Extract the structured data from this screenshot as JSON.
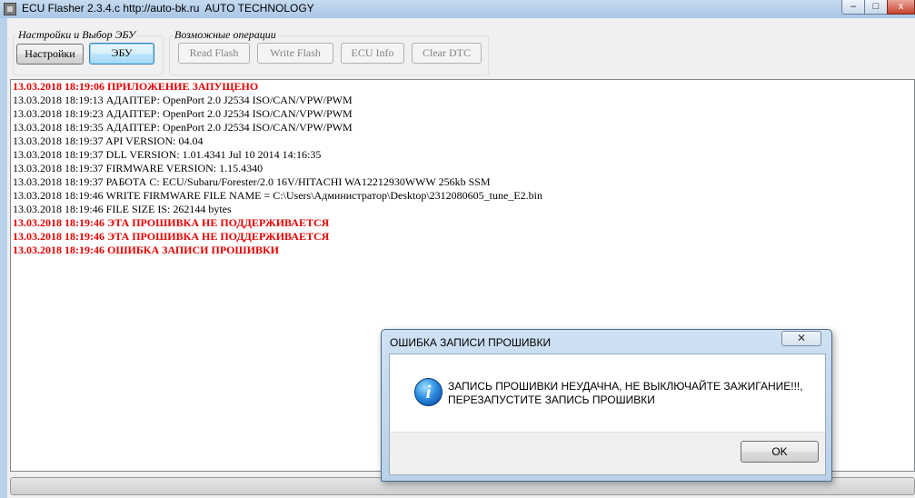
{
  "window": {
    "title": "ECU Flasher 2.3.4.c http://auto-bk.ru  AUTO TECHNOLOGY",
    "minimize_glyph": "–",
    "maximize_glyph": "□",
    "close_glyph": "x"
  },
  "groups": {
    "settings_label": "Настройки и Выбор ЭБУ",
    "operations_label": "Возможные операции"
  },
  "buttons": {
    "settings": "Настройки",
    "ecu": "ЭБУ",
    "read_flash": "Read Flash",
    "write_flash": "Write Flash",
    "ecu_info": "ECU Info",
    "clear_dtc": "Clear DTC"
  },
  "log": [
    {
      "text": "13.03.2018 18:19:06 ПРИЛОЖЕНИЕ ЗАПУЩЕНО",
      "error": true
    },
    {
      "text": "13.03.2018 18:19:13 АДАПТЕР: OpenPort 2.0 J2534 ISO/CAN/VPW/PWM",
      "error": false
    },
    {
      "text": "13.03.2018 18:19:23 АДАПТЕР: OpenPort 2.0 J2534 ISO/CAN/VPW/PWM",
      "error": false
    },
    {
      "text": "13.03.2018 18:19:35 АДАПТЕР: OpenPort 2.0 J2534 ISO/CAN/VPW/PWM",
      "error": false
    },
    {
      "text": "13.03.2018 18:19:37 API VERSION: 04.04",
      "error": false
    },
    {
      "text": "13.03.2018 18:19:37 DLL VERSION: 1.01.4341 Jul 10 2014 14:16:35",
      "error": false
    },
    {
      "text": "13.03.2018 18:19:37 FIRMWARE VERSION: 1.15.4340",
      "error": false
    },
    {
      "text": "13.03.2018 18:19:37 РАБОТА С: ECU/Subaru/Forester/2.0 16V/HITACHI WA12212930WWW 256kb SSM",
      "error": false
    },
    {
      "text": "13.03.2018 18:19:46 WRITE FIRMWARE FILE NAME = C:\\Users\\Администратор\\Desktop\\2312080605_tune_E2.bin",
      "error": false
    },
    {
      "text": "13.03.2018 18:19:46 FILE SIZE IS: 262144 bytes",
      "error": false
    },
    {
      "text": "13.03.2018 18:19:46 ЭТА ПРОШИВКА НЕ ПОДДЕРЖИВАЕТСЯ",
      "error": true
    },
    {
      "text": "13.03.2018 18:19:46 ЭТА ПРОШИВКА НЕ ПОДДЕРЖИВАЕТСЯ",
      "error": true
    },
    {
      "text": "13.03.2018 18:19:46 ОШИБКА ЗАПИСИ ПРОШИВКИ",
      "error": true
    }
  ],
  "log_colors": {
    "normal": "#000000",
    "error": "#e60000"
  },
  "progress": {
    "value": 0
  },
  "dialog": {
    "title": "ОШИБКА ЗАПИСИ ПРОШИВКИ",
    "close_glyph": "✕",
    "icon": "info-icon",
    "icon_glyph": "i",
    "message_line1": "ЗАПИСЬ ПРОШИВКИ НЕУДАЧНА, НЕ ВЫКЛЮЧАЙТЕ ЗАЖИГАНИЕ!!!,",
    "message_line2": "ПЕРЕЗАПУСТИТЕ ЗАПИСЬ ПРОШИВКИ",
    "ok_label": "OK"
  }
}
